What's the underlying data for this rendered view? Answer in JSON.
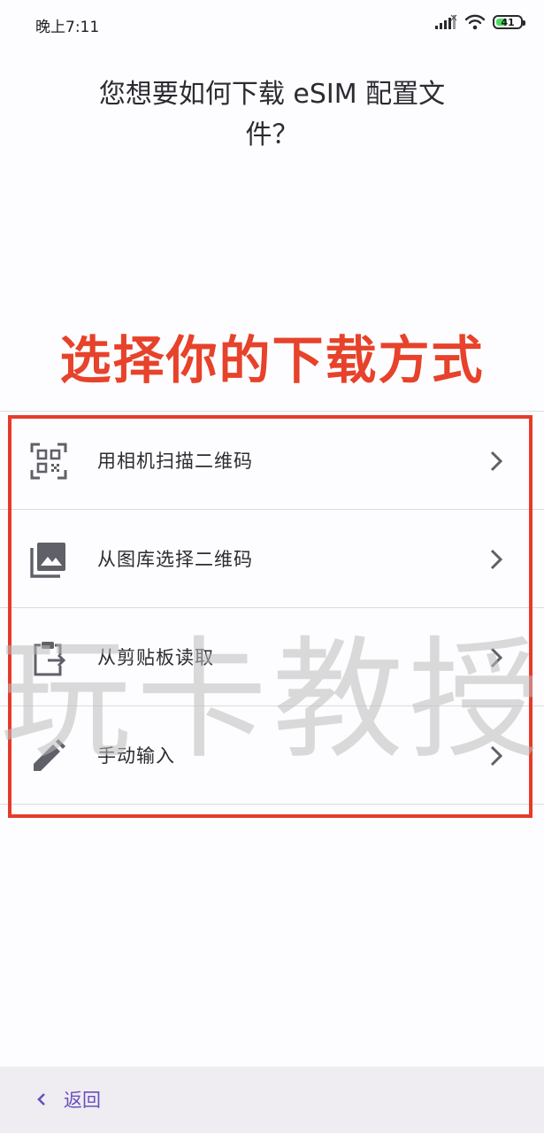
{
  "status_bar": {
    "time": "晚上7:11",
    "battery_level": "41",
    "icons": [
      "signal-icon",
      "wifi-icon",
      "battery-icon"
    ]
  },
  "page": {
    "title": "您想要如何下载 eSIM 配置文件？"
  },
  "promo_text": "选择你的下载方式",
  "options": [
    {
      "label": "用相机扫描二维码",
      "icon": "qr-scan-icon"
    },
    {
      "label": "从图库选择二维码",
      "icon": "gallery-icon"
    },
    {
      "label": "从剪贴板读取",
      "icon": "clipboard-icon"
    },
    {
      "label": "手动输入",
      "icon": "pencil-icon"
    }
  ],
  "watermark": "玩卡教授",
  "bottom": {
    "back_label": "返回"
  },
  "colors": {
    "accent": "#6a4fbf",
    "highlight": "#e63b2a",
    "promo": "#e7422b",
    "icon": "#5f6068"
  }
}
